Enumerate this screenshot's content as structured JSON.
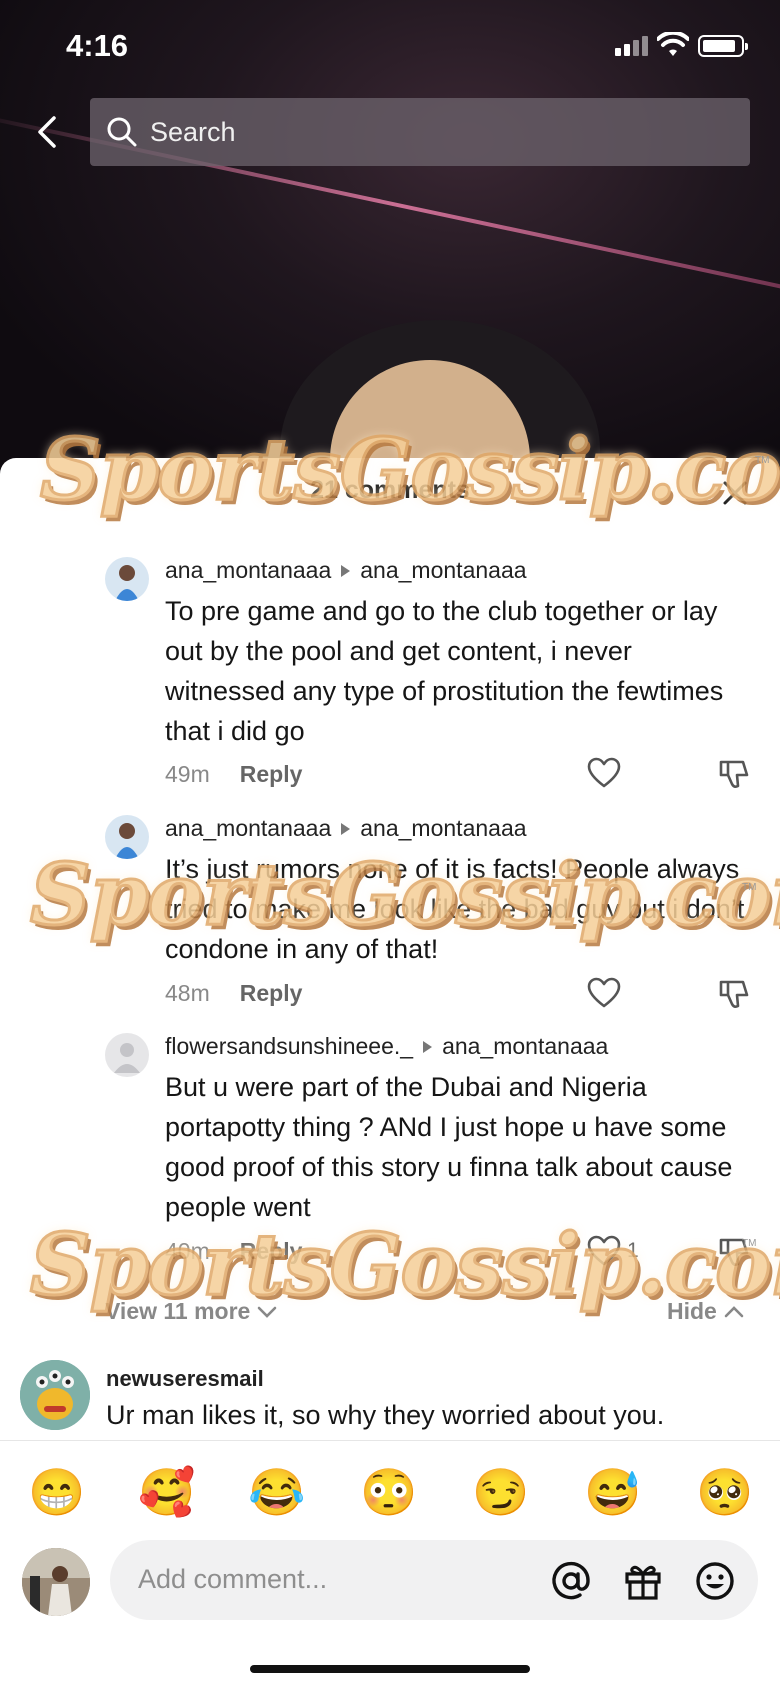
{
  "status_bar": {
    "time": "4:16"
  },
  "search": {
    "placeholder": "Search"
  },
  "sheet": {
    "title": "21 comments"
  },
  "comments": [
    {
      "user": "ana_montanaaa",
      "reply_to": "ana_montanaaa",
      "text": "To pre game and go to the club together or lay out by the pool and get content, i never witnessed any type of prostitution the fewtimes that i did go",
      "age": "49m",
      "reply_label": "Reply",
      "likes": ""
    },
    {
      "user": "ana_montanaaa",
      "reply_to": "ana_montanaaa",
      "text": "It’s just rumors none of it is facts! People always tried to make me look like the bad guy but i don’t condone in any of that!",
      "age": "48m",
      "reply_label": "Reply",
      "likes": ""
    },
    {
      "user": "flowersandsunshineee._",
      "reply_to": "ana_montanaaa",
      "text": "But u were part of the Dubai and Nigeria portapotty thing ? ANd I just hope u have some good proof of this story u finna talk about cause people went",
      "age": "40m",
      "reply_label": "Reply",
      "likes": "1"
    }
  ],
  "thread": {
    "view_more": "View 11 more",
    "hide": "Hide"
  },
  "top_comment": {
    "user": "newuseresmail",
    "text": "Ur man likes it, so why they worried about you."
  },
  "emojis": [
    "😁",
    "🥰",
    "😂",
    "😳",
    "😏",
    "😅",
    "🥺"
  ],
  "input": {
    "placeholder": "Add comment..."
  },
  "watermark": {
    "text": "SportsGossip.com",
    "tm": "TM"
  }
}
